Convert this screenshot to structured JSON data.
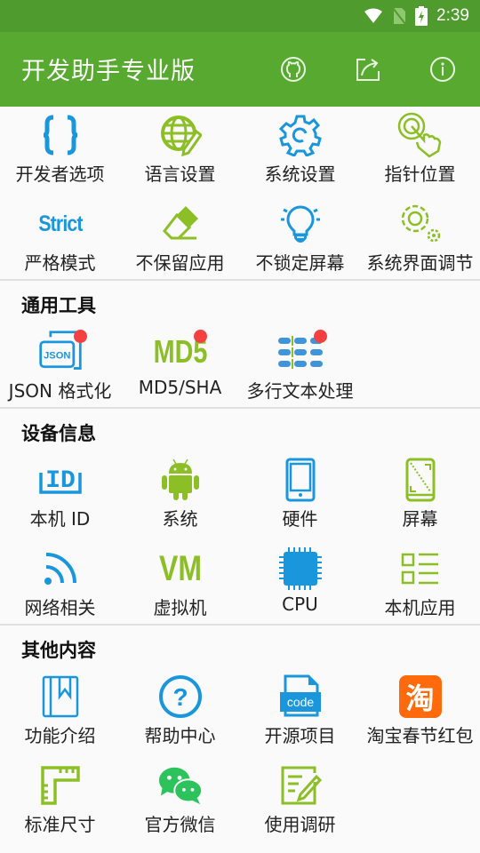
{
  "status_bar": {
    "time": "2:39",
    "icons": [
      "wifi-icon",
      "no-sim-icon",
      "battery-charging-icon"
    ]
  },
  "app_bar": {
    "title": "开发助手专业版",
    "actions": [
      {
        "name": "github-icon"
      },
      {
        "name": "share-icon"
      },
      {
        "name": "info-icon"
      }
    ]
  },
  "colors": {
    "primary": "#57a92f",
    "status_bar": "#4f9b2d",
    "blue": "#1a96dd",
    "green": "#8cbf26",
    "badge": "#f44040"
  },
  "quick_settings": [
    {
      "label": "开发者选项",
      "icon": "braces-icon"
    },
    {
      "label": "语言设置",
      "icon": "globe-pencil-icon"
    },
    {
      "label": "系统设置",
      "icon": "gear-icon"
    },
    {
      "label": "指针位置",
      "icon": "touch-icon"
    },
    {
      "label": "严格模式",
      "icon": "strict-text-icon",
      "icon_text": "Strict"
    },
    {
      "label": "不保留应用",
      "icon": "eraser-icon"
    },
    {
      "label": "不锁定屏幕",
      "icon": "lightbulb-icon"
    },
    {
      "label": "系统界面调节",
      "icon": "gears-icon"
    }
  ],
  "sections": [
    {
      "title": "通用工具",
      "items": [
        {
          "label": "JSON 格式化",
          "icon": "json-icon",
          "icon_text": "JSON",
          "badge": true
        },
        {
          "label": "MD5/SHA",
          "icon": "md5-icon",
          "icon_text": "MD5",
          "badge": true
        },
        {
          "label": "多行文本处理",
          "icon": "multiline-text-icon",
          "badge": true
        }
      ]
    },
    {
      "title": "设备信息",
      "items": [
        {
          "label": "本机 ID",
          "icon": "id-icon",
          "icon_text": "ID"
        },
        {
          "label": "系统",
          "icon": "android-icon"
        },
        {
          "label": "硬件",
          "icon": "phone-icon"
        },
        {
          "label": "屏幕",
          "icon": "screen-icon"
        },
        {
          "label": "网络相关",
          "icon": "rss-icon"
        },
        {
          "label": "虚拟机",
          "icon": "vm-icon",
          "icon_text": "VM"
        },
        {
          "label": "CPU",
          "icon": "cpu-icon"
        },
        {
          "label": "本机应用",
          "icon": "app-list-icon"
        }
      ]
    },
    {
      "title": "其他内容",
      "items": [
        {
          "label": "功能介绍",
          "icon": "book-icon"
        },
        {
          "label": "帮助中心",
          "icon": "help-icon",
          "icon_text": "?"
        },
        {
          "label": "开源项目",
          "icon": "code-file-icon",
          "icon_text": "code"
        },
        {
          "label": "淘宝春节红包",
          "icon": "taobao-icon",
          "icon_text": "淘"
        },
        {
          "label": "标准尺寸",
          "icon": "ruler-icon"
        },
        {
          "label": "官方微信",
          "icon": "wechat-icon"
        },
        {
          "label": "使用调研",
          "icon": "survey-icon"
        }
      ]
    }
  ]
}
